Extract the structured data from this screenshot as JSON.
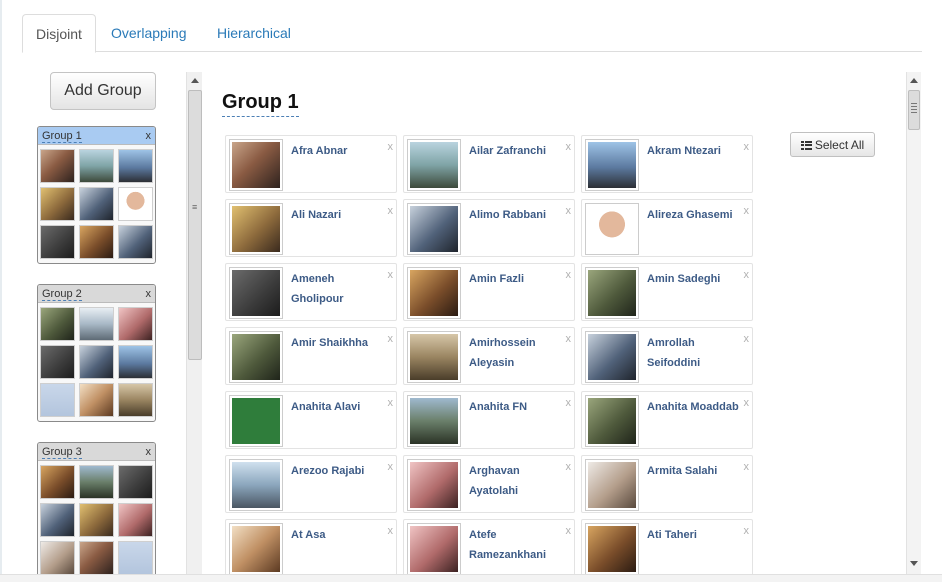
{
  "tabs": [
    {
      "label": "Disjoint",
      "active": true
    },
    {
      "label": "Overlapping",
      "active": false
    },
    {
      "label": "Hierarchical",
      "active": false
    }
  ],
  "sidebar": {
    "add_group_label": "Add Group",
    "groups": [
      {
        "name": "Group 1",
        "close": "x",
        "selected": true
      },
      {
        "name": "Group 2",
        "close": "x",
        "selected": false
      },
      {
        "name": "Group 3",
        "close": "x",
        "selected": false
      }
    ],
    "scroll_grip": "≡"
  },
  "main": {
    "title": "Group 1",
    "select_all_label": "Select All",
    "remove_label": "x",
    "members": [
      {
        "name": "Afra Abnar"
      },
      {
        "name": "Ailar Zafranchi"
      },
      {
        "name": "Akram Ntezari"
      },
      {
        "name": "Ali Nazari"
      },
      {
        "name": "Alimo Rabbani"
      },
      {
        "name": "Alireza Ghasemi"
      },
      {
        "name": "Ameneh Gholipour"
      },
      {
        "name": "Amin Fazli"
      },
      {
        "name": "Amin Sadeghi"
      },
      {
        "name": "Amir Shaikhha"
      },
      {
        "name": "Amirhossein Aleyasin"
      },
      {
        "name": "Amrollah Seifoddini"
      },
      {
        "name": "Anahita Alavi"
      },
      {
        "name": "Anahita FN"
      },
      {
        "name": "Anahita Moaddab"
      },
      {
        "name": "Arezoo Rajabi"
      },
      {
        "name": "Arghavan Ayatolahi"
      },
      {
        "name": "Armita Salahi"
      },
      {
        "name": "At Asa"
      },
      {
        "name": "Atefe Ramezankhani"
      },
      {
        "name": "Ati Taheri"
      }
    ]
  }
}
